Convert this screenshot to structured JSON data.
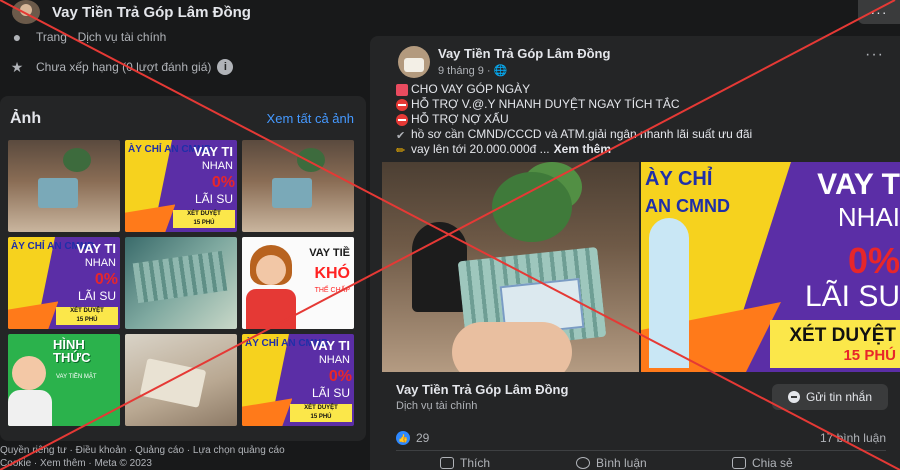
{
  "page": {
    "name": "Vay Tiền Trả Góp Lâm Đồng",
    "category_label": "Trang · Dịch vụ tài chính",
    "rating_text": "Chưa xếp hạng (0 lượt đánh giá)",
    "info_icon": "i"
  },
  "photos": {
    "title": "Ảnh",
    "see_all": "Xem tất cả ảnh",
    "ad_texts": {
      "vay": "VAY TI",
      "nhanh": "NHAN",
      "zero": "0%",
      "lai": "LÃI SU",
      "xet": "XÉT DUYỆT",
      "phut": "15 PHÚ",
      "cmnd": "ÀY CHỈ AN CMND",
      "vay_tien": "VAY TIỀ",
      "kho": "KHÓ",
      "the_chap": "THẾ CHẤP",
      "hinh_thuc": "HÌNH THỨC",
      "vay_tien_mat": "VAY TIỀN MẶT"
    }
  },
  "footer": {
    "line1": "Quyền riêng tư · Điều khoản · Quảng cáo · Lựa chọn quảng cáo",
    "line2": "Cookie · Xem thêm · Meta © 2023"
  },
  "post": {
    "author": "Vay Tiền Trả Góp Lâm Đồng",
    "time": "9 tháng 9 · 🌐",
    "more": "···",
    "lines": [
      "CHO VAY GÓP NGÀY",
      "HỖ TRỢ V.@.Y NHANH DUYỆT NGAY TÍCH TẮC",
      "HỖ TRỢ NỢ XẤU",
      "hồ sơ cần CMND/CCCD và ATM.giải ngân nhanh lãi suất ưu đãi",
      "vay lên tới 20.000.000đ ..."
    ],
    "see_more": "Xem thêm",
    "image_right": {
      "cy1": "ÀY CHỈ",
      "cy2": "AN CMND",
      "vay": "VAY T",
      "nhan": "NHAI",
      "zero": "0%",
      "lai": "LÃI SU",
      "xet": "XÉT DUYỆT",
      "phut": "15 PHÚ"
    },
    "link_name": "Vay Tiền Trả Góp Lâm Đồng",
    "link_sub": "Dịch vụ tài chính",
    "message_button": "Gửi tin nhắn",
    "likes": "29",
    "comments": "17 bình luận",
    "actions": [
      "Thích",
      "Bình luận",
      "Chia sẻ"
    ]
  },
  "corner_more": "···",
  "colors": {
    "background": "#18191a",
    "card": "#242526",
    "accent_link": "#4599ff",
    "overlay_red": "#e53935"
  }
}
